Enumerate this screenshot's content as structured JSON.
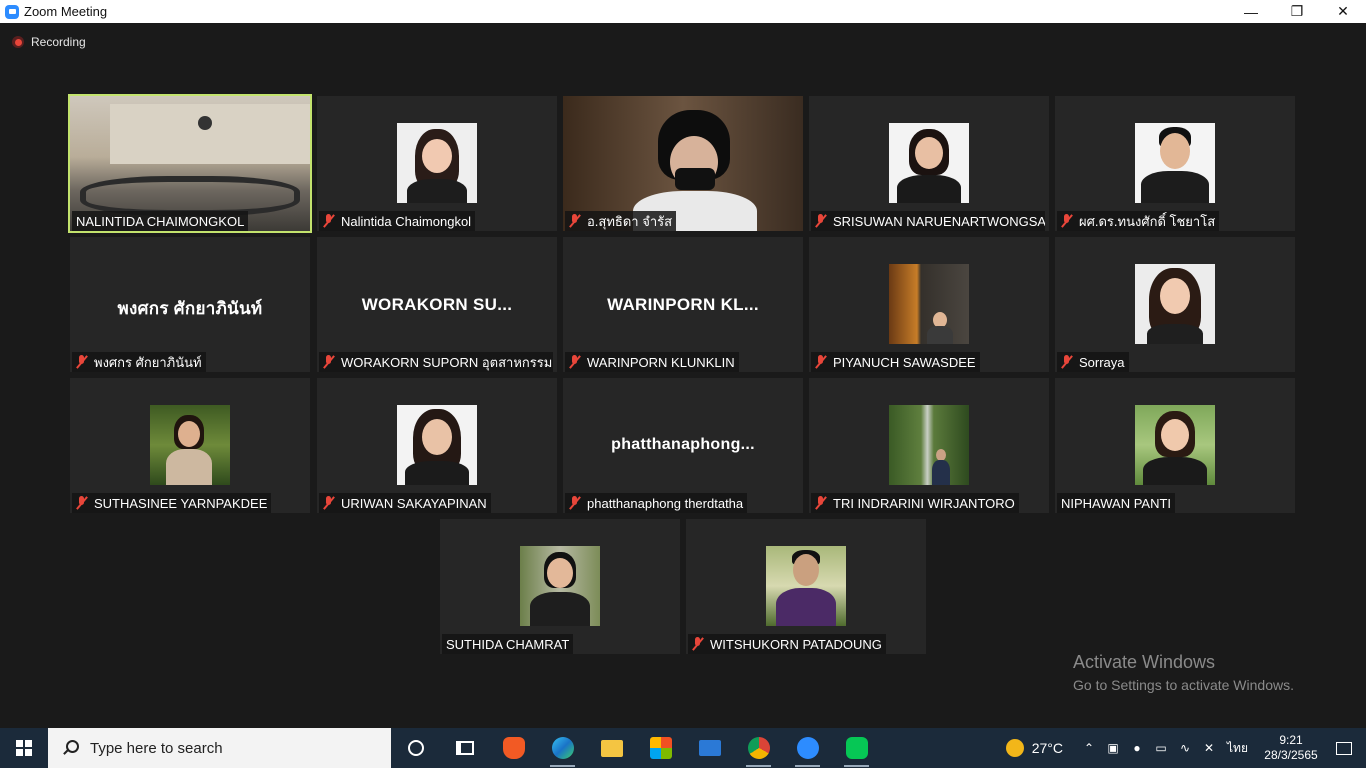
{
  "window": {
    "title": "Zoom Meeting"
  },
  "recording": {
    "label": "Recording"
  },
  "participants": [
    {
      "name": "NALINTIDA CHAIMONGKOL",
      "muted": false,
      "type": "video-room"
    },
    {
      "name": "Nalintida Chaimongkol",
      "muted": true,
      "type": "photo"
    },
    {
      "name": "อ.สุทธิดา จำรัส",
      "muted": true,
      "type": "video-cam"
    },
    {
      "name": "SRISUWAN NARUENARTWONGSAK...",
      "muted": true,
      "type": "photo"
    },
    {
      "name": "ผศ.ดร.ทนงศักดิ์ โชยาโส",
      "muted": true,
      "type": "photo"
    },
    {
      "name": "พงศกร ศักยาภินันท์",
      "muted": true,
      "type": "text",
      "display": "พงศกร ศักยาภินันท์"
    },
    {
      "name": "WORAKORN SUPORN อุตสาหกรรมเก...",
      "muted": true,
      "type": "text",
      "display": "WORAKORN  SU..."
    },
    {
      "name": "WARINPORN KLUNKLIN",
      "muted": true,
      "type": "text",
      "display": "WARINPORN  KL..."
    },
    {
      "name": "PIYANUCH SAWASDEE",
      "muted": true,
      "type": "photo"
    },
    {
      "name": "Sorraya",
      "muted": true,
      "type": "photo"
    },
    {
      "name": "SUTHASINEE YARNPAKDEE",
      "muted": true,
      "type": "photo"
    },
    {
      "name": "URIWAN SAKAYAPINAN",
      "muted": true,
      "type": "photo"
    },
    {
      "name": "phatthanaphong therdtatha",
      "muted": true,
      "type": "text",
      "display": "phatthanaphong..."
    },
    {
      "name": "TRI INDRARINI WIRJANTORO",
      "muted": true,
      "type": "photo"
    },
    {
      "name": "NIPHAWAN PANTI",
      "muted": false,
      "type": "photo"
    },
    {
      "name": "SUTHIDA CHAMRAT",
      "muted": false,
      "type": "photo"
    },
    {
      "name": "WITSHUKORN PATADOUNG",
      "muted": true,
      "type": "photo"
    }
  ],
  "activation": {
    "title": "Activate Windows",
    "subtitle": "Go to Settings to activate Windows."
  },
  "taskbar": {
    "search_placeholder": "Type here to search",
    "apps": [
      "brave-icon",
      "edge-icon",
      "file-explorer-icon",
      "store-icon",
      "mail-icon",
      "chrome-icon",
      "zoom-icon",
      "line-icon"
    ],
    "weather_temp": "27°C",
    "language": "ไทย",
    "time": "9:21",
    "date": "28/3/2565"
  }
}
